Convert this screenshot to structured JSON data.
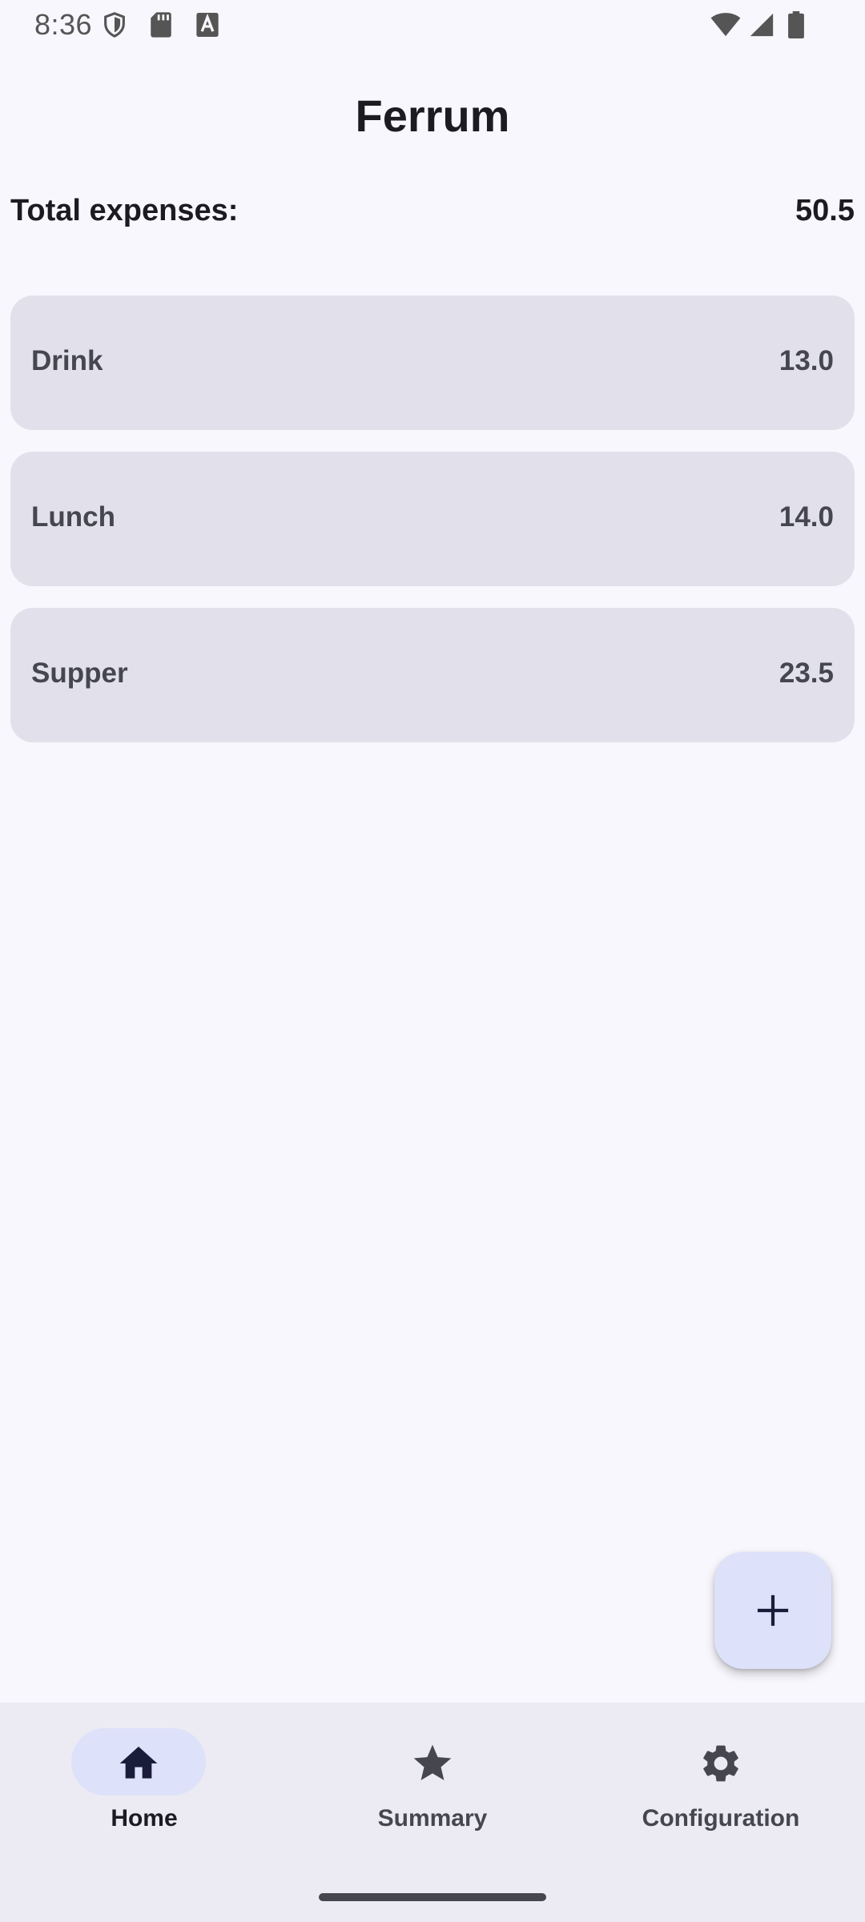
{
  "status_bar": {
    "time": "8:36",
    "icons_left": [
      "shield-icon",
      "sd-card-icon",
      "text-a-icon"
    ],
    "icons_right": [
      "wifi-icon",
      "cell-signal-icon",
      "battery-icon"
    ]
  },
  "app": {
    "title": "Ferrum"
  },
  "summary": {
    "total_label": "Total expenses:",
    "total_value": "50.5"
  },
  "expenses": [
    {
      "name": "Drink",
      "amount": "13.0"
    },
    {
      "name": "Lunch",
      "amount": "14.0"
    },
    {
      "name": "Supper",
      "amount": "23.5"
    }
  ],
  "fab": {
    "icon": "plus-icon"
  },
  "bottom_nav": {
    "items": [
      {
        "label": "Home",
        "icon": "home-icon",
        "selected": true
      },
      {
        "label": "Summary",
        "icon": "star-icon",
        "selected": false
      },
      {
        "label": "Configuration",
        "icon": "gear-icon",
        "selected": false
      }
    ]
  },
  "colors": {
    "background": "#f8f7fd",
    "card": "#e2e1eb",
    "fab": "#dde1fa",
    "nav_background": "#ecebf3",
    "nav_indicator": "#dde1fa",
    "text_primary": "#1b1b21",
    "text_secondary": "#45464f"
  }
}
